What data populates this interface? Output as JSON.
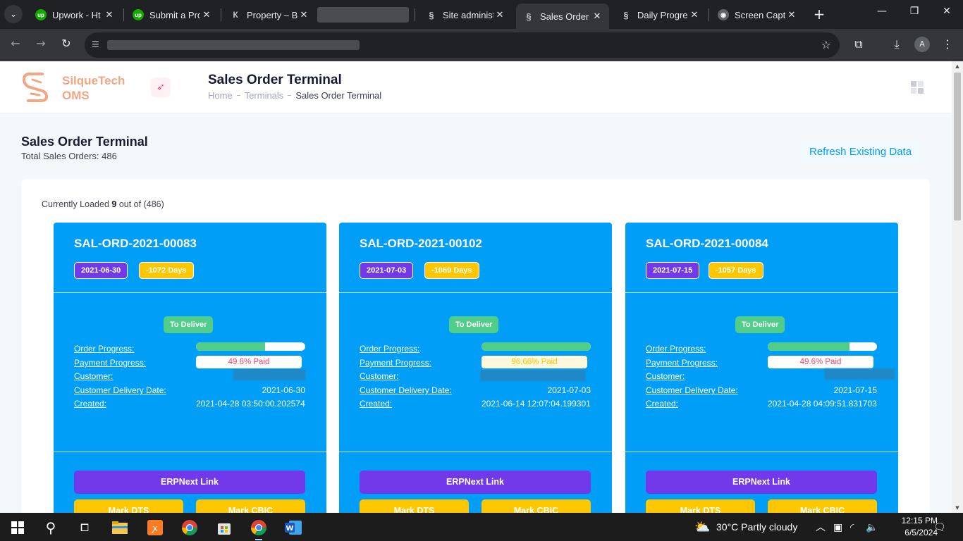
{
  "browser": {
    "tabs": [
      {
        "title": "Upwork - Ht",
        "favicon": "upwork-icon",
        "active": false
      },
      {
        "title": "Submit a Pro",
        "favicon": "upwork-icon",
        "active": false
      },
      {
        "title": "Property – B",
        "favicon": "property-icon",
        "active": false
      },
      {
        "title": "",
        "favicon": "redacted",
        "active": false
      },
      {
        "title": "Site administ",
        "favicon": "silque-icon",
        "active": false
      },
      {
        "title": "Sales Order T",
        "favicon": "silque-icon",
        "active": true
      },
      {
        "title": "Daily Progre",
        "favicon": "silque-icon",
        "active": false
      },
      {
        "title": "Screen Captu",
        "favicon": "camera-icon",
        "active": false
      }
    ],
    "profile_initial": "A"
  },
  "app": {
    "brand_line1": "SilqueTech",
    "brand_line2": "OMS",
    "page_title": "Sales Order Terminal",
    "breadcrumb": [
      "Home",
      "Terminals",
      "Sales Order Terminal"
    ]
  },
  "section": {
    "title": "Sales Order Terminal",
    "subtitle": "Total Sales Orders: 486",
    "refresh_label": "Refresh Existing Data",
    "loaded_prefix": "Currently Loaded",
    "loaded_count": "9",
    "loaded_suffix": "out of (486)"
  },
  "labels": {
    "order_progress": "Order Progress:",
    "payment_progress": "Payment Progress:",
    "customer": "Customer:",
    "delivery_date": "Customer Delivery Date:",
    "created": "Created:",
    "erp_link": "ERPNext Link",
    "mark_dts": "Mark DTS",
    "mark_cbic": "Mark CBIC"
  },
  "orders": [
    {
      "id": "SAL-ORD-2021-00083",
      "date": "2021-06-30",
      "days": "-1072 Days",
      "status": "To Deliver",
      "order_progress": 0.63,
      "payment": "49.6% Paid",
      "payment_level": "partial",
      "delivery_date": "2021-06-30",
      "created": "2021-04-28 03:50:00.202574"
    },
    {
      "id": "SAL-ORD-2021-00102",
      "date": "2021-07-03",
      "days": "-1069 Days",
      "status": "To Deliver",
      "order_progress": 1.0,
      "payment": "96.66% Paid",
      "payment_level": "high",
      "delivery_date": "2021-07-03",
      "created": "2021-06-14 12:07:04.199301"
    },
    {
      "id": "SAL-ORD-2021-00084",
      "date": "2021-07-15",
      "days": "-1057 Days",
      "status": "To Deliver",
      "order_progress": 0.75,
      "payment": "49.6% Paid",
      "payment_level": "partial",
      "delivery_date": "2021-07-15",
      "created": "2021-04-28 04:09:51.831703"
    }
  ],
  "taskbar": {
    "weather": "30°C  Partly cloudy",
    "time": "12:15 PM",
    "date": "6/5/2024"
  },
  "colors": {
    "card_bg": "#009ef7",
    "purple": "#7239ea",
    "yellow": "#ffc700",
    "green": "#50cd89",
    "brand_orange": "#f4a683",
    "paid_partial_text": "#f1416c",
    "paid_high_text": "#ffc700",
    "paid_high_bg": "#fff8dd"
  }
}
